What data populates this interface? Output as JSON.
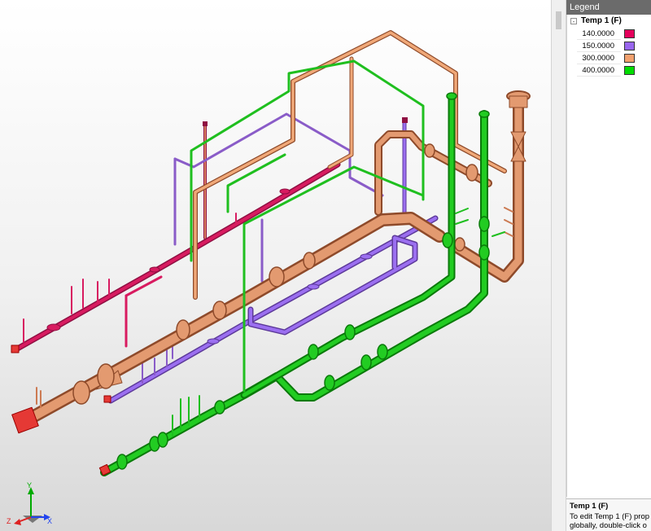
{
  "legend": {
    "title": "Legend",
    "group": {
      "label": "Temp 1 (F)",
      "expander": "-",
      "items": [
        {
          "value": "140.0000",
          "color": "#e5005c"
        },
        {
          "value": "150.0000",
          "color": "#9966ee"
        },
        {
          "value": "300.0000",
          "color": "#f2a06e"
        },
        {
          "value": "400.0000",
          "color": "#00dd00"
        }
      ]
    }
  },
  "info": {
    "title": "Temp 1 (F)",
    "line1": "To edit Temp 1 (F) prop",
    "line2": "globally, double-click o"
  },
  "axis": {
    "y": "Y",
    "z": "Z",
    "x": "X"
  },
  "colors": {
    "magenta_pipe": "#c2185b",
    "violet_pipe": "#8a5cc8",
    "copper_pipe": "#cc7a52",
    "green_pipe": "#1fbf1f"
  }
}
